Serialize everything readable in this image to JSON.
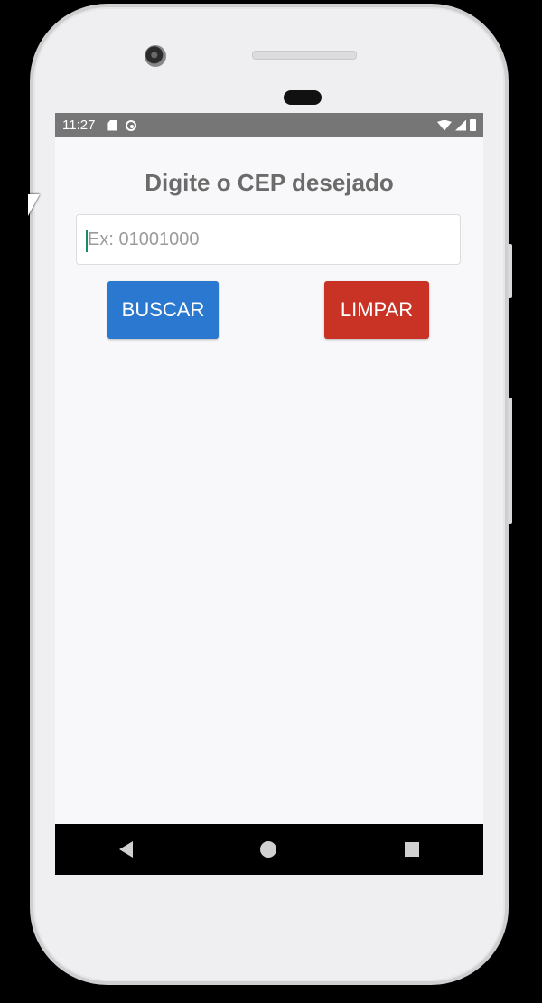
{
  "status_bar": {
    "time": "11:27",
    "left_icons": [
      "sd-card-icon",
      "sync-icon"
    ],
    "right_icons": [
      "wifi-icon",
      "signal-icon",
      "battery-icon"
    ]
  },
  "app": {
    "title": "Digite o CEP desejado",
    "cep_input": {
      "value": "",
      "placeholder": "Ex: 01001000"
    },
    "buttons": {
      "search_label": "BUSCAR",
      "clear_label": "LIMPAR"
    }
  },
  "navigation_bar": {
    "icons": [
      "back-icon",
      "home-icon",
      "recents-icon"
    ]
  },
  "colors": {
    "search_button": "#2a78cf",
    "clear_button": "#c93326",
    "title_text": "#6b6b6b",
    "status_bar": "#767676",
    "screen_background": "#f8f8fa"
  }
}
